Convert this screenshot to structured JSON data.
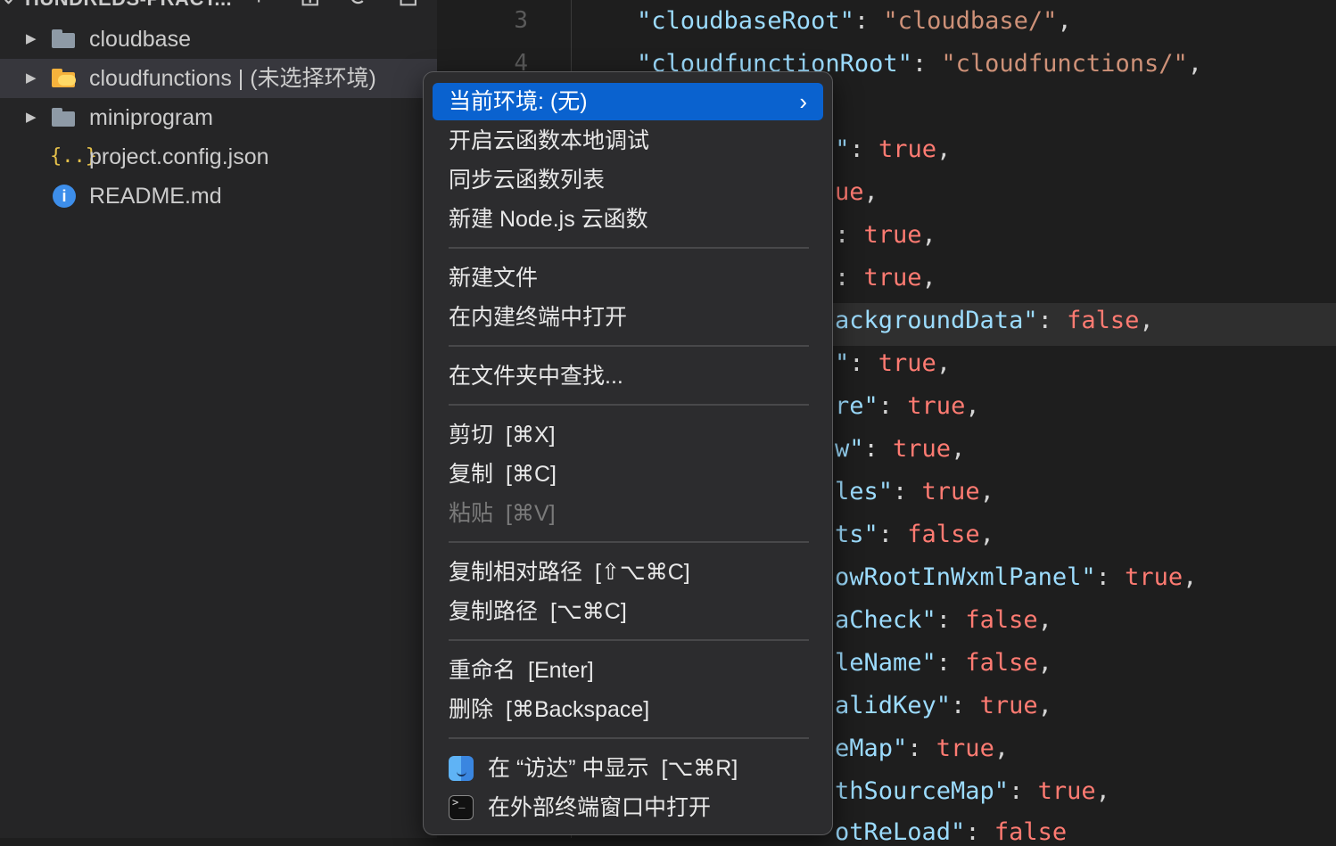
{
  "sidebar": {
    "header_title": "HUNDREDS-PRACT...",
    "items": [
      {
        "label": "cloudbase",
        "icon": "folder-icon"
      },
      {
        "label": "cloudfunctions | (未选择环境)",
        "icon": "cloud-folder-icon"
      },
      {
        "label": "miniprogram",
        "icon": "folder-icon"
      },
      {
        "label": "project.config.json",
        "icon": "json-braces-icon"
      },
      {
        "label": "README.md",
        "icon": "info-icon"
      }
    ],
    "json_glyph": "{..}",
    "info_glyph": "i"
  },
  "editor": {
    "line_numbers": [
      "3",
      "4"
    ],
    "lines": [
      {
        "key": "\"cloudbaseRoot\"",
        "sep": ": ",
        "val": "\"cloudbase/\"",
        "end": ","
      },
      {
        "key": "\"cloudfunctionRoot\"",
        "sep": ": ",
        "val": "\"cloudfunctions/\"",
        "end": ","
      },
      {
        "key": "t\"",
        "sep": ": ",
        "val": "true",
        "end": ","
      },
      {
        "key": "ue",
        "sep": "",
        "val": "",
        "end": ","
      },
      {
        "key": "",
        "sep": ": ",
        "val": "true",
        "end": ","
      },
      {
        "key": "",
        "sep": ": ",
        "val": "true",
        "end": ","
      },
      {
        "key": "ackgroundData\"",
        "sep": ": ",
        "val": "false",
        "end": ","
      },
      {
        "key": "\"",
        "sep": ": ",
        "val": "true",
        "end": ","
      },
      {
        "key": "re\"",
        "sep": ": ",
        "val": "true",
        "end": ","
      },
      {
        "key": "w\"",
        "sep": ": ",
        "val": "true",
        "end": ","
      },
      {
        "key": "les\"",
        "sep": ": ",
        "val": "true",
        "end": ","
      },
      {
        "key": "ts\"",
        "sep": ": ",
        "val": "false",
        "end": ","
      },
      {
        "key": "owRootInWxmlPanel\"",
        "sep": ": ",
        "val": "true",
        "end": ","
      },
      {
        "key": "aCheck\"",
        "sep": ": ",
        "val": "false",
        "end": ","
      },
      {
        "key": "leName\"",
        "sep": ": ",
        "val": "false",
        "end": ","
      },
      {
        "key": "alidKey\"",
        "sep": ": ",
        "val": "true",
        "end": ","
      },
      {
        "key": "eMap\"",
        "sep": ": ",
        "val": "true",
        "end": ","
      },
      {
        "key": "thSourceMap\"",
        "sep": ": ",
        "val": "true",
        "end": ","
      },
      {
        "key": "otReLoad\"",
        "sep": ": ",
        "val": "false",
        "end": ""
      }
    ]
  },
  "context_menu": {
    "items": [
      {
        "label": "当前环境: (无)",
        "shortcut": "",
        "state": "active",
        "submenu": true
      },
      {
        "label": "开启云函数本地调试",
        "shortcut": ""
      },
      {
        "label": "同步云函数列表",
        "shortcut": ""
      },
      {
        "label": "新建 Node.js 云函数",
        "shortcut": ""
      },
      {
        "label": "新建文件",
        "shortcut": ""
      },
      {
        "label": "在内建终端中打开",
        "shortcut": ""
      },
      {
        "label": "在文件夹中查找...",
        "shortcut": ""
      },
      {
        "label": "剪切",
        "shortcut": "[⌘X]"
      },
      {
        "label": "复制",
        "shortcut": "[⌘C]"
      },
      {
        "label": "粘贴",
        "shortcut": "[⌘V]",
        "state": "disabled"
      },
      {
        "label": "复制相对路径",
        "shortcut": "[⇧⌥⌘C]"
      },
      {
        "label": "复制路径",
        "shortcut": "[⌥⌘C]"
      },
      {
        "label": "重命名",
        "shortcut": "[Enter]"
      },
      {
        "label": "删除",
        "shortcut": "[⌘Backspace]"
      },
      {
        "label": "在 “访达” 中显示",
        "shortcut": "[⌥⌘R]",
        "icon": "finder-icon"
      },
      {
        "label": "在外部终端窗口中打开",
        "shortcut": "",
        "icon": "terminal-icon"
      }
    ],
    "submenu_arrow": "›",
    "terminal_glyph": ">_"
  },
  "colors": {
    "menu_highlight": "#0a62cf",
    "json_key": "#9cdcfe",
    "json_string": "#ce9178",
    "json_bool": "#ff7b72"
  }
}
